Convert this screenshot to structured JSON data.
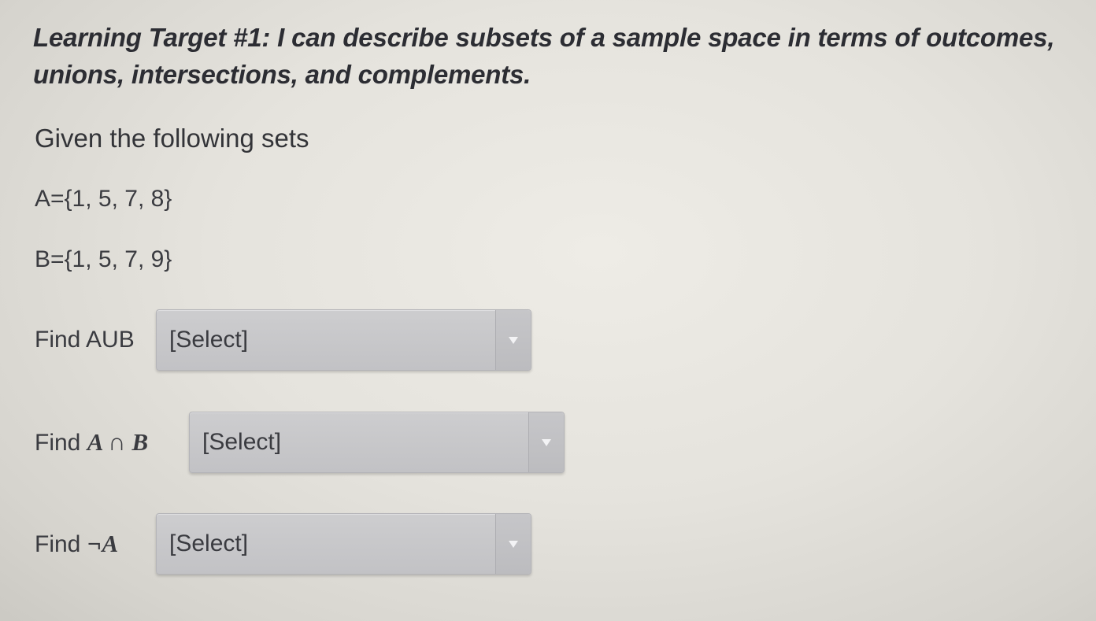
{
  "learning_target": {
    "text": "Learning Target #1: I can describe subsets of a sample space in terms of outcomes, unions, intersections, and complements."
  },
  "given_text": "Given the following sets",
  "sets": {
    "a": "A={1, 5, 7, 8}",
    "b": "B={1, 5, 7, 9}"
  },
  "questions": [
    {
      "label_prefix": "Find AUB",
      "symbol": "",
      "selected": "[Select]"
    },
    {
      "label_prefix": "Find",
      "symbol": "A ∩ B",
      "selected": "[Select]"
    },
    {
      "label_prefix": "Find",
      "symbol": "¬A",
      "selected": "[Select]"
    }
  ]
}
